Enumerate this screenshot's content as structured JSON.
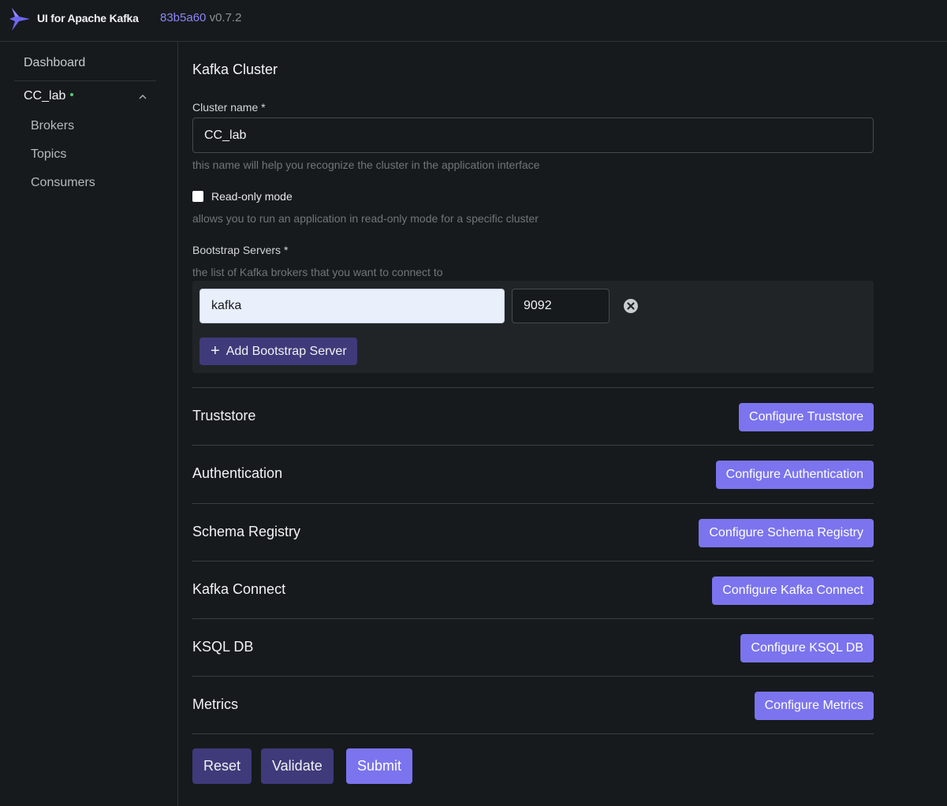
{
  "header": {
    "app_title": "UI for Apache Kafka",
    "version_hash": "83b5a60",
    "version": "v0.7.2",
    "logo_icon": "kafka-bird-icon"
  },
  "sidebar": {
    "dashboard": "Dashboard",
    "cluster": {
      "name": "CC_lab",
      "status": "online",
      "status_color": "#5ac878"
    },
    "items": [
      {
        "label": "Brokers"
      },
      {
        "label": "Topics"
      },
      {
        "label": "Consumers"
      }
    ]
  },
  "form": {
    "heading": "Kafka Cluster",
    "cluster_name": {
      "label": "Cluster name *",
      "value": "CC_lab",
      "hint": "this name will help you recognize the cluster in the application interface"
    },
    "read_only": {
      "label": "Read-only mode",
      "checked": false,
      "hint": "allows you to run an application in read-only mode for a specific cluster"
    },
    "bootstrap": {
      "label": "Bootstrap Servers *",
      "hint": "the list of Kafka brokers that you want to connect to",
      "servers": [
        {
          "host": "kafka",
          "port": "9092"
        }
      ],
      "add_label": "Add Bootstrap Server"
    },
    "sections": [
      {
        "title": "Truststore",
        "button": "Configure Truststore"
      },
      {
        "title": "Authentication",
        "button": "Configure Authentication"
      },
      {
        "title": "Schema Registry",
        "button": "Configure Schema Registry"
      },
      {
        "title": "Kafka Connect",
        "button": "Configure Kafka Connect"
      },
      {
        "title": "KSQL DB",
        "button": "Configure KSQL DB"
      },
      {
        "title": "Metrics",
        "button": "Configure Metrics"
      }
    ],
    "actions": {
      "reset": "Reset",
      "validate": "Validate",
      "submit": "Submit"
    }
  },
  "colors": {
    "accent": "#7b74ee",
    "accent_dark": "#3f3a7a",
    "background": "#171a1c"
  }
}
